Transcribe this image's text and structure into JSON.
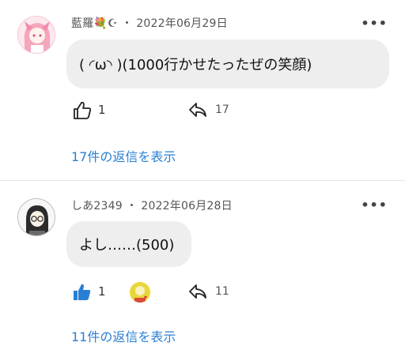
{
  "comments": [
    {
      "username": "藍羅💐☪︎",
      "separator": "・",
      "date": "2022年06月29日",
      "more_label": "•••",
      "text": "( ◜ω◝ )(1000行かせたったぜの笑顔)",
      "likes": "1",
      "liked": false,
      "replies_count": "17",
      "view_replies": "17件の返信を表示"
    },
    {
      "username": "しあ2349",
      "separator": "・",
      "date": "2022年06月28日",
      "more_label": "•••",
      "text": "よし……(500)",
      "likes": "1",
      "liked": true,
      "has_creator_badge": true,
      "replies_count": "11",
      "view_replies": "11件の返信を表示"
    }
  ],
  "colors": {
    "link": "#2a7fd4",
    "like_active": "#2a7fd4",
    "bubble_bg": "#eeeeee",
    "meta_text": "#555555"
  }
}
